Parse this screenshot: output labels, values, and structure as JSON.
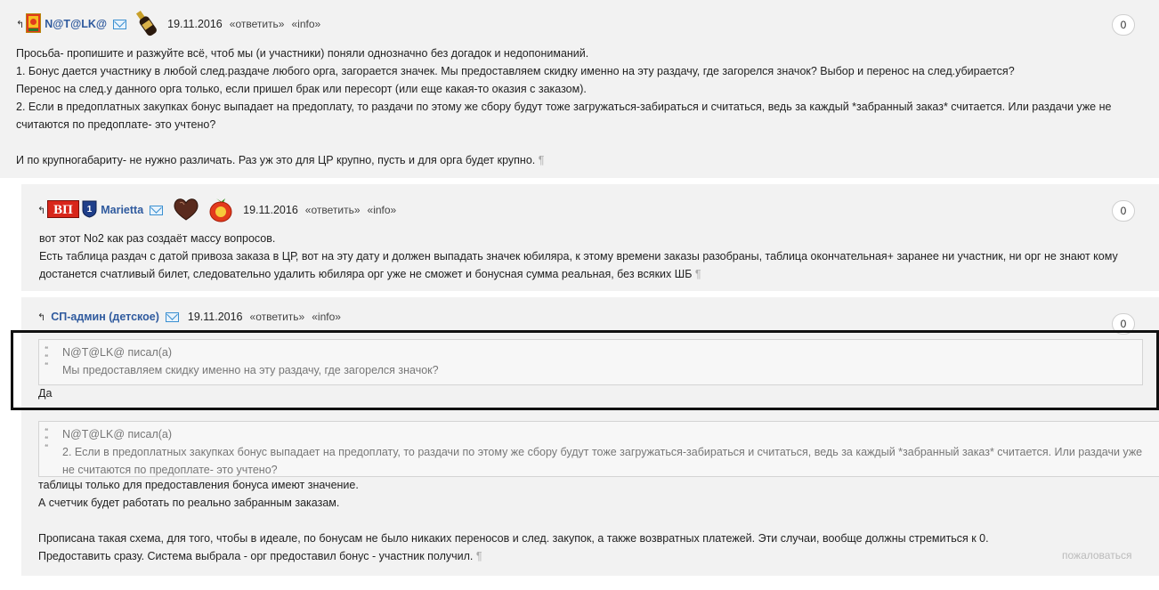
{
  "post1": {
    "author": "N@T@LK@",
    "date": "19.11.2016",
    "reply": "«ответить»",
    "info": "«info»",
    "counter": "0",
    "lines": [
      "Просьба- пропишите и разжуйте всё, чтоб мы (и участники) поняли однозначно без догадок и недопониманий.",
      "1. Бонус дается участнику в любой след.раздаче любого орга, загорается значек. Мы предоставляем скидку именно на эту раздачу, где загорелся значок? Выбор и перенос на след.убирается?",
      "Перенос на след.у данного орга только, если пришел брак или пересорт (или еще какая-то оказия с заказом).",
      "2. Если в предоплатных закупках бонус выпадает на предоплату, то раздачи по этому же сбору будут тоже загружаться-забираться и считаться, ведь за каждый *забранный заказ* считается. Или раздачи уже не",
      "считаются по предоплате- это учтено?",
      "",
      "И по крупногабариту- не нужно различать. Раз уж это для ЦР крупно, пусть и для орга будет крупно."
    ],
    "pilcrow": "¶"
  },
  "post2": {
    "badge": "ВП",
    "rank": "1",
    "author": "Marietta",
    "date": "19.11.2016",
    "reply": "«ответить»",
    "info": "«info»",
    "counter": "0",
    "lines": [
      "вот этот No2 как раз создаёт массу вопросов.",
      "Есть таблица раздач с датой привоза заказа в ЦР, вот на эту дату и должен выпадать значек юбиляра, к этому времени заказы разобраны, таблица окончательная+ заранее ни участник, ни орг не знают кому",
      "достанется счатливый билет, следовательно удалить юбиляра орг уже не сможет и бонусная сумма реальная, без всяких ШБ"
    ],
    "pilcrow": "¶"
  },
  "post3": {
    "author": "СП-админ (детское)",
    "date": "19.11.2016",
    "reply": "«ответить»",
    "info": "«info»",
    "counter": "0",
    "quote1": {
      "author": "N@T@LK@ писал(а)",
      "text": "Мы предоставляем скидку именно на эту раздачу, где загорелся значок?"
    },
    "answer1": "Да",
    "quote2": {
      "author": "N@T@LK@ писал(а)",
      "text": "2. Если в предоплатных закупках бонус выпадает на предоплату, то раздачи по этому же сбору будут тоже загружаться-забираться и считаться, ведь за каждый *забранный заказ* считается. Или раздачи уже не считаются по предоплате- это учтено?"
    },
    "lines": [
      "таблицы только для предоставления бонуса имеют значение.",
      "А счетчик будет работать по реально забранным заказам.",
      "",
      "Прописана такая схема, для того, чтобы в идеале, по бонусам не было никаких переносов и след. закупок, а также возвратных платежей. Эти случаи, вообще должны стремиться к 0.",
      "Предоставить сразу. Система выбрала - орг предоставил бонус - участник получил."
    ],
    "pilcrow": "¶",
    "complain": "пожаловаться"
  }
}
